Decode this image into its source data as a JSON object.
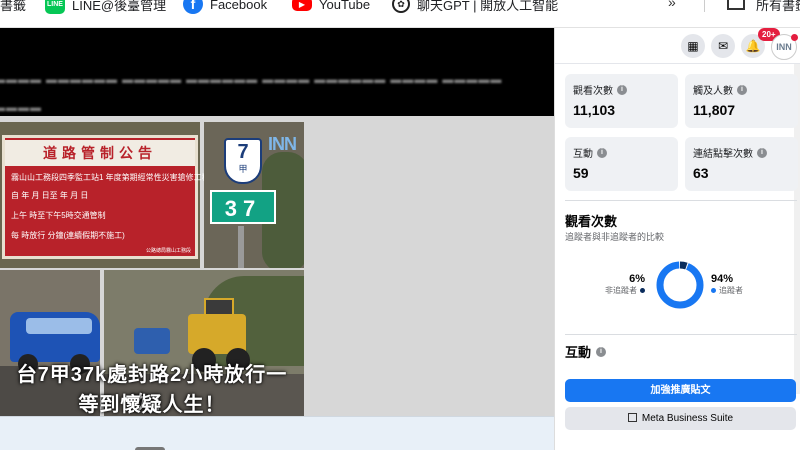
{
  "bookmarks": {
    "items": [
      {
        "label": "書籤",
        "icon": "bookmark-folder-icon"
      },
      {
        "label": "LINE@後臺管理",
        "icon": "line-icon"
      },
      {
        "label": "Facebook",
        "icon": "facebook-icon"
      },
      {
        "label": "YouTube",
        "icon": "youtube-icon"
      },
      {
        "label": "聊天GPT | 開放人工智能",
        "icon": "chatgpt-icon"
      }
    ],
    "overflow": "»",
    "all_bookmarks_label": "所有書籤"
  },
  "video": {
    "sign": {
      "title": "道路管制公告",
      "lines": [
        "霧山山工務段四季監工站1  年度第期經常性災害搶修工程",
        "自  年  月  日至  年  月  日",
        "上午  時至下午5時交通管制",
        "每  時放行  分鐘(連續假期不施工)"
      ],
      "footer": "公路總局霧山工務段"
    },
    "route": {
      "number": "7",
      "sub": "甲",
      "km": "37"
    },
    "watermark": "INN",
    "title_line1": "台7甲37k處封路2小時放行一次：",
    "title_line2": "等到懷疑人生！"
  },
  "panel": {
    "notifications_badge": "20+",
    "avatar_text": "INN",
    "stats": [
      {
        "label": "觀看次數",
        "value": "11,103"
      },
      {
        "label": "觸及人數",
        "value": "11,807"
      },
      {
        "label": "互動",
        "value": "59"
      },
      {
        "label": "連結點擊次數",
        "value": "63"
      }
    ],
    "views_section": {
      "title": "觀看次數",
      "subtitle": "追蹤者與非追蹤者的比較",
      "non_followers": {
        "pct": "6%",
        "label": "非追蹤者",
        "value": 6
      },
      "followers": {
        "pct": "94%",
        "label": "追蹤者",
        "value": 94
      }
    },
    "engagement_section": {
      "title": "互動"
    },
    "boost_button": "加強推廣貼文",
    "mbs_button": "Meta Business Suite"
  },
  "colors": {
    "accent": "#1877f2",
    "non_followers": "#0a2c5c",
    "followers": "#1877f2",
    "badge": "#e41e3f"
  }
}
